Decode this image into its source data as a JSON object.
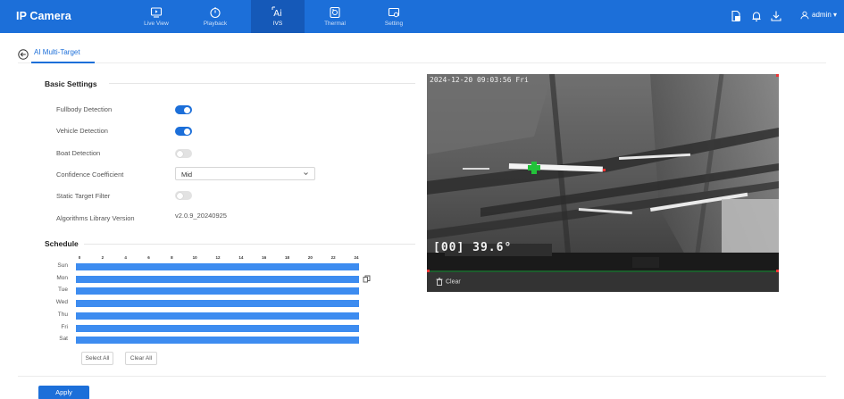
{
  "header": {
    "brand": "IP Camera",
    "nav": [
      {
        "label": "Live View",
        "icon": "monitor-icon"
      },
      {
        "label": "Playback",
        "icon": "playback-icon"
      },
      {
        "label": "IVS",
        "icon": "ai-icon"
      },
      {
        "label": "Thermal",
        "icon": "thermal-icon"
      },
      {
        "label": "Setting",
        "icon": "setting-icon"
      }
    ],
    "active_nav": "IVS",
    "user": "admin ▾"
  },
  "tab": {
    "label": "AI Multi-Target"
  },
  "basic_settings": {
    "title": "Basic Settings",
    "fullbody_label": "Fullbody Detection",
    "fullbody_on": true,
    "vehicle_label": "Vehicle Detection",
    "vehicle_on": true,
    "boat_label": "Boat Detection",
    "boat_on": false,
    "confidence_label": "Confidence Coefficient",
    "confidence_value": "Mid",
    "static_filter_label": "Static Target Filter",
    "static_filter_on": false,
    "version_label": "Algorithms Library Version",
    "version_value": "v2.0.9_20240925"
  },
  "schedule": {
    "title": "Schedule",
    "hours": [
      "0",
      "2",
      "4",
      "6",
      "8",
      "10",
      "12",
      "14",
      "16",
      "18",
      "20",
      "22",
      "24"
    ],
    "days": [
      "Sun",
      "Mon",
      "Tue",
      "Wed",
      "Thu",
      "Fri",
      "Sat"
    ],
    "select_all": "Select All",
    "clear_all": "Clear All"
  },
  "apply_label": "Apply",
  "video": {
    "timestamp": "2024-12-20 09:03:56 Fri",
    "temperature": "[00] 39.6°",
    "clear_label": "Clear"
  },
  "colors": {
    "primary": "#1c6fd9",
    "schedule_bar": "#3d8cf0",
    "toggle_off": "#e2e2e2"
  }
}
